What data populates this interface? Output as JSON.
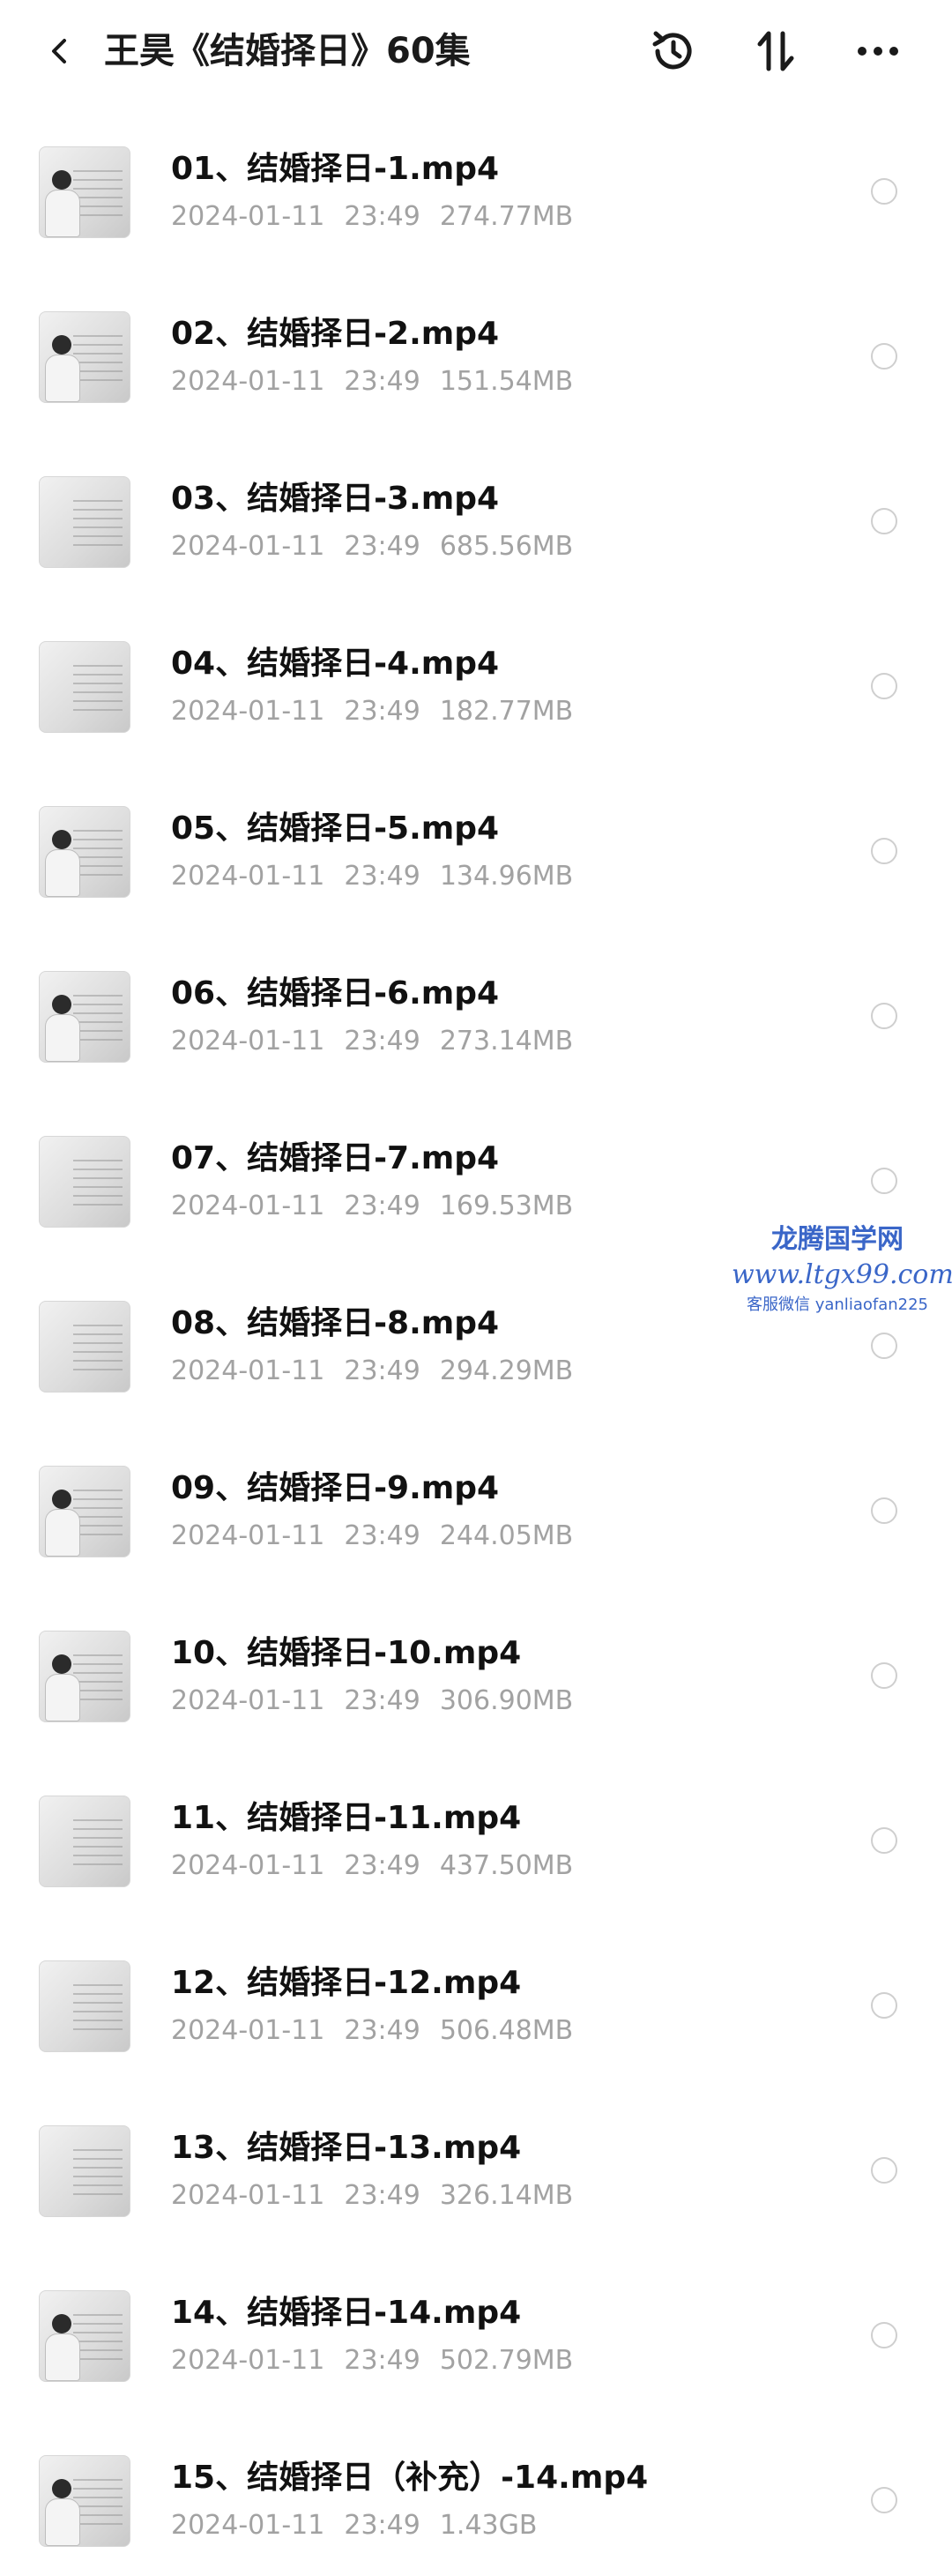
{
  "header": {
    "title": "王昊《结婚择日》60集",
    "back_icon": "chevron-left-icon",
    "history_icon": "history-icon",
    "sort_icon": "sort-icon",
    "more_icon": "more-icon"
  },
  "files": [
    {
      "name": "01、结婚择日-1.mp4",
      "date": "2024-01-11",
      "time": "23:49",
      "size": "274.77MB",
      "thumb": "person"
    },
    {
      "name": "02、结婚择日-2.mp4",
      "date": "2024-01-11",
      "time": "23:49",
      "size": "151.54MB",
      "thumb": "person"
    },
    {
      "name": "03、结婚择日-3.mp4",
      "date": "2024-01-11",
      "time": "23:49",
      "size": "685.56MB",
      "thumb": "board"
    },
    {
      "name": "04、结婚择日-4.mp4",
      "date": "2024-01-11",
      "time": "23:49",
      "size": "182.77MB",
      "thumb": "board"
    },
    {
      "name": "05、结婚择日-5.mp4",
      "date": "2024-01-11",
      "time": "23:49",
      "size": "134.96MB",
      "thumb": "person"
    },
    {
      "name": "06、结婚择日-6.mp4",
      "date": "2024-01-11",
      "time": "23:49",
      "size": "273.14MB",
      "thumb": "person"
    },
    {
      "name": "07、结婚择日-7.mp4",
      "date": "2024-01-11",
      "time": "23:49",
      "size": "169.53MB",
      "thumb": "board"
    },
    {
      "name": "08、结婚择日-8.mp4",
      "date": "2024-01-11",
      "time": "23:49",
      "size": "294.29MB",
      "thumb": "board"
    },
    {
      "name": "09、结婚择日-9.mp4",
      "date": "2024-01-11",
      "time": "23:49",
      "size": "244.05MB",
      "thumb": "person"
    },
    {
      "name": "10、结婚择日-10.mp4",
      "date": "2024-01-11",
      "time": "23:49",
      "size": "306.90MB",
      "thumb": "person"
    },
    {
      "name": "11、结婚择日-11.mp4",
      "date": "2024-01-11",
      "time": "23:49",
      "size": "437.50MB",
      "thumb": "board"
    },
    {
      "name": "12、结婚择日-12.mp4",
      "date": "2024-01-11",
      "time": "23:49",
      "size": "506.48MB",
      "thumb": "board"
    },
    {
      "name": "13、结婚择日-13.mp4",
      "date": "2024-01-11",
      "time": "23:49",
      "size": "326.14MB",
      "thumb": "board"
    },
    {
      "name": "14、结婚择日-14.mp4",
      "date": "2024-01-11",
      "time": "23:49",
      "size": "502.79MB",
      "thumb": "person"
    },
    {
      "name": "15、结婚择日（补充）-14.mp4",
      "date": "2024-01-11",
      "time": "23:49",
      "size": "1.43GB",
      "thumb": "person"
    }
  ],
  "watermark": {
    "line1": "龙腾国学网",
    "line2": "www.ltgx99.com",
    "line3": "客服微信 yanliaofan225"
  },
  "colors": {
    "title_text": "#1a1a1a",
    "meta_text": "#a2a2a2",
    "watermark": "#3a66c8",
    "background": "#ffffff"
  }
}
